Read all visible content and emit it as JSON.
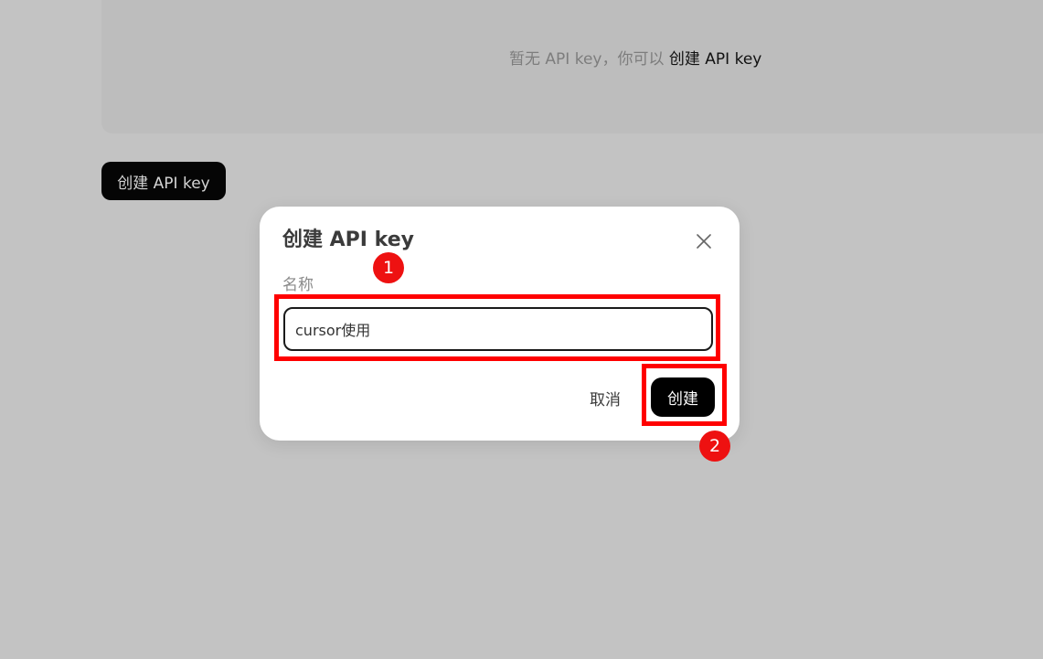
{
  "empty_state": {
    "text": "暂无 API key，你可以",
    "link": "创建 API key"
  },
  "toolbar": {
    "create_button": "创建 API key"
  },
  "dialog": {
    "title": "创建 API key",
    "name_label": "名称",
    "name_value": "cursor使用",
    "cancel": "取消",
    "submit": "创建"
  },
  "annotations": [
    {
      "step": "1"
    },
    {
      "step": "2"
    }
  ],
  "colors": {
    "overlay": "#c3c3c3",
    "primary": "#000000",
    "annotation": "#ff0000"
  }
}
